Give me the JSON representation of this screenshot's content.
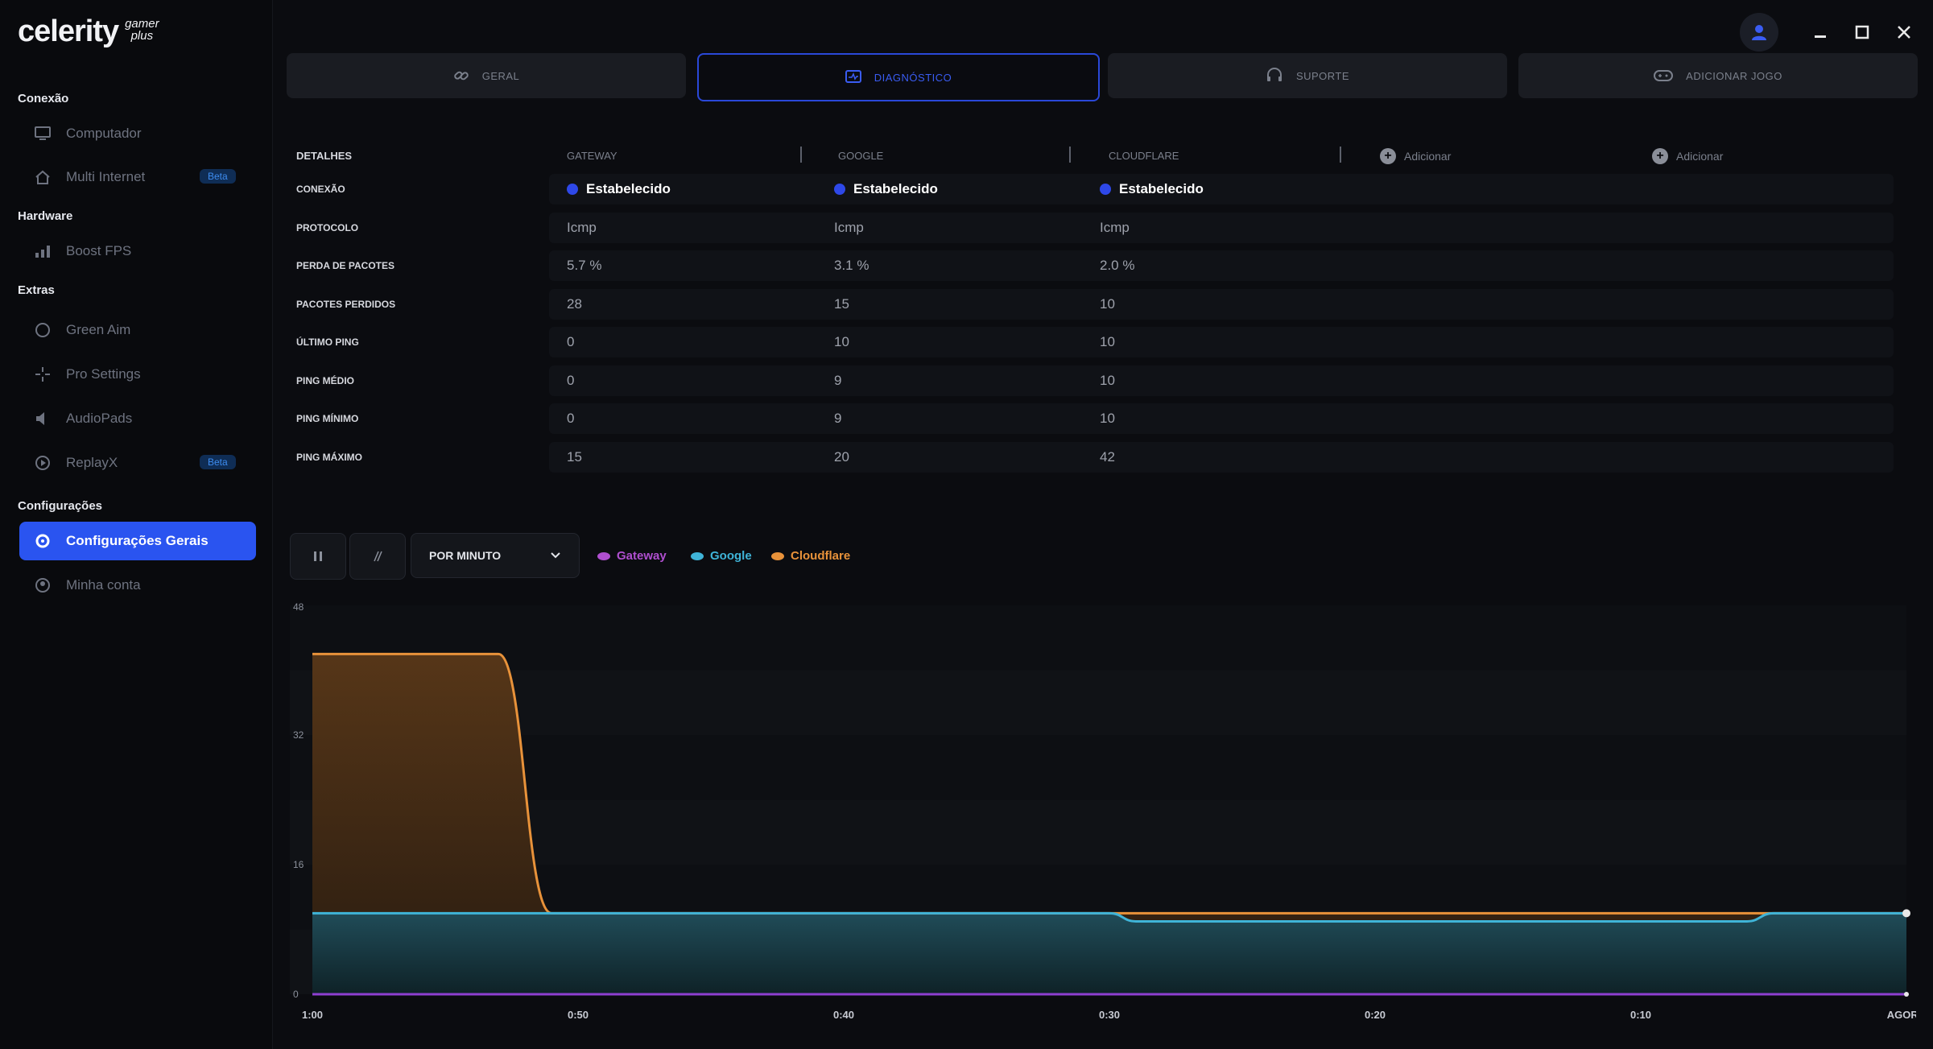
{
  "app": {
    "logo_main": "celerity",
    "logo_sub_1": "gamer",
    "logo_sub_2": "plus"
  },
  "sidebar": {
    "sections": [
      {
        "title": "Conexão",
        "items": [
          {
            "label": "Computador",
            "icon": "monitor-icon"
          },
          {
            "label": "Multi Internet",
            "icon": "home-icon",
            "badge": "Beta"
          }
        ]
      },
      {
        "title": "Hardware",
        "items": [
          {
            "label": "Boost FPS",
            "icon": "bar-chart-icon"
          }
        ]
      },
      {
        "title": "Extras",
        "items": [
          {
            "label": "Green Aim",
            "icon": "circle-icon"
          },
          {
            "label": "Pro Settings",
            "icon": "crosshair-icon"
          },
          {
            "label": "AudioPads",
            "icon": "speaker-icon"
          },
          {
            "label": "ReplayX",
            "icon": "replay-icon",
            "badge": "Beta"
          }
        ]
      },
      {
        "title": "Configurações",
        "items": [
          {
            "label": "Configurações Gerais",
            "icon": "gear-icon",
            "active": true
          },
          {
            "label": "Minha conta",
            "icon": "user-circle-icon"
          }
        ]
      }
    ]
  },
  "tabs": [
    {
      "label": "GERAL",
      "icon": "link-icon"
    },
    {
      "label": "DIAGNÓSTICO",
      "icon": "diagnostic-icon",
      "active": true
    },
    {
      "label": "SUPORTE",
      "icon": "headset-icon"
    },
    {
      "label": "ADICIONAR JOGO",
      "icon": "gamepad-icon"
    }
  ],
  "table": {
    "details_header": "DETALHES",
    "columns": [
      "GATEWAY",
      "GOOGLE",
      "CLOUDFLARE"
    ],
    "add_label": "Adicionar",
    "rows": [
      {
        "label": "CONEXÃO",
        "values": [
          "Estabelecido",
          "Estabelecido",
          "Estabelecido"
        ]
      },
      {
        "label": "PROTOCOLO",
        "values": [
          "Icmp",
          "Icmp",
          "Icmp"
        ]
      },
      {
        "label": "PERDA DE PACOTES",
        "values": [
          "5.7 %",
          "3.1 %",
          "2.0 %"
        ]
      },
      {
        "label": "PACOTES PERDIDOS",
        "values": [
          "28",
          "15",
          "10"
        ]
      },
      {
        "label": "ÚLTIMO PING",
        "values": [
          "0",
          "10",
          "10"
        ]
      },
      {
        "label": "PING MÉDIO",
        "values": [
          "0",
          "9",
          "10"
        ]
      },
      {
        "label": "PING MÍNIMO",
        "values": [
          "0",
          "9",
          "10"
        ]
      },
      {
        "label": "PING MÁXIMO",
        "values": [
          "15",
          "20",
          "42"
        ]
      }
    ]
  },
  "chart_controls": {
    "period": "POR MINUTO",
    "legend": [
      {
        "name": "Gateway",
        "color": "#b04fd0"
      },
      {
        "name": "Google",
        "color": "#3fb4d8"
      },
      {
        "name": "Cloudflare",
        "color": "#e8923a"
      }
    ]
  },
  "chart_data": {
    "type": "area",
    "x": [
      "1:00",
      "0:50",
      "0:40",
      "0:30",
      "0:20",
      "0:10",
      "AGORA"
    ],
    "x_seconds_ago": [
      60,
      56,
      52,
      51,
      41,
      30,
      29,
      6,
      5,
      0
    ],
    "yticks": [
      0,
      16,
      32,
      48
    ],
    "ylim": [
      0,
      48
    ],
    "series": [
      {
        "name": "Cloudflare",
        "color": "#e8923a",
        "points": [
          [
            60,
            42
          ],
          [
            53,
            42
          ],
          [
            51,
            10
          ],
          [
            0,
            10
          ]
        ]
      },
      {
        "name": "Google",
        "color": "#3fb4d8",
        "points": [
          [
            60,
            10
          ],
          [
            30,
            10
          ],
          [
            29,
            9
          ],
          [
            6,
            9
          ],
          [
            5,
            10
          ],
          [
            0,
            10
          ]
        ]
      },
      {
        "name": "Gateway",
        "color": "#8e3fd0",
        "points": [
          [
            60,
            0
          ],
          [
            0,
            0
          ]
        ]
      }
    ]
  },
  "colors": {
    "accent": "#2a54f0",
    "background": "#0b0c10",
    "panel": "#1a1c22"
  }
}
